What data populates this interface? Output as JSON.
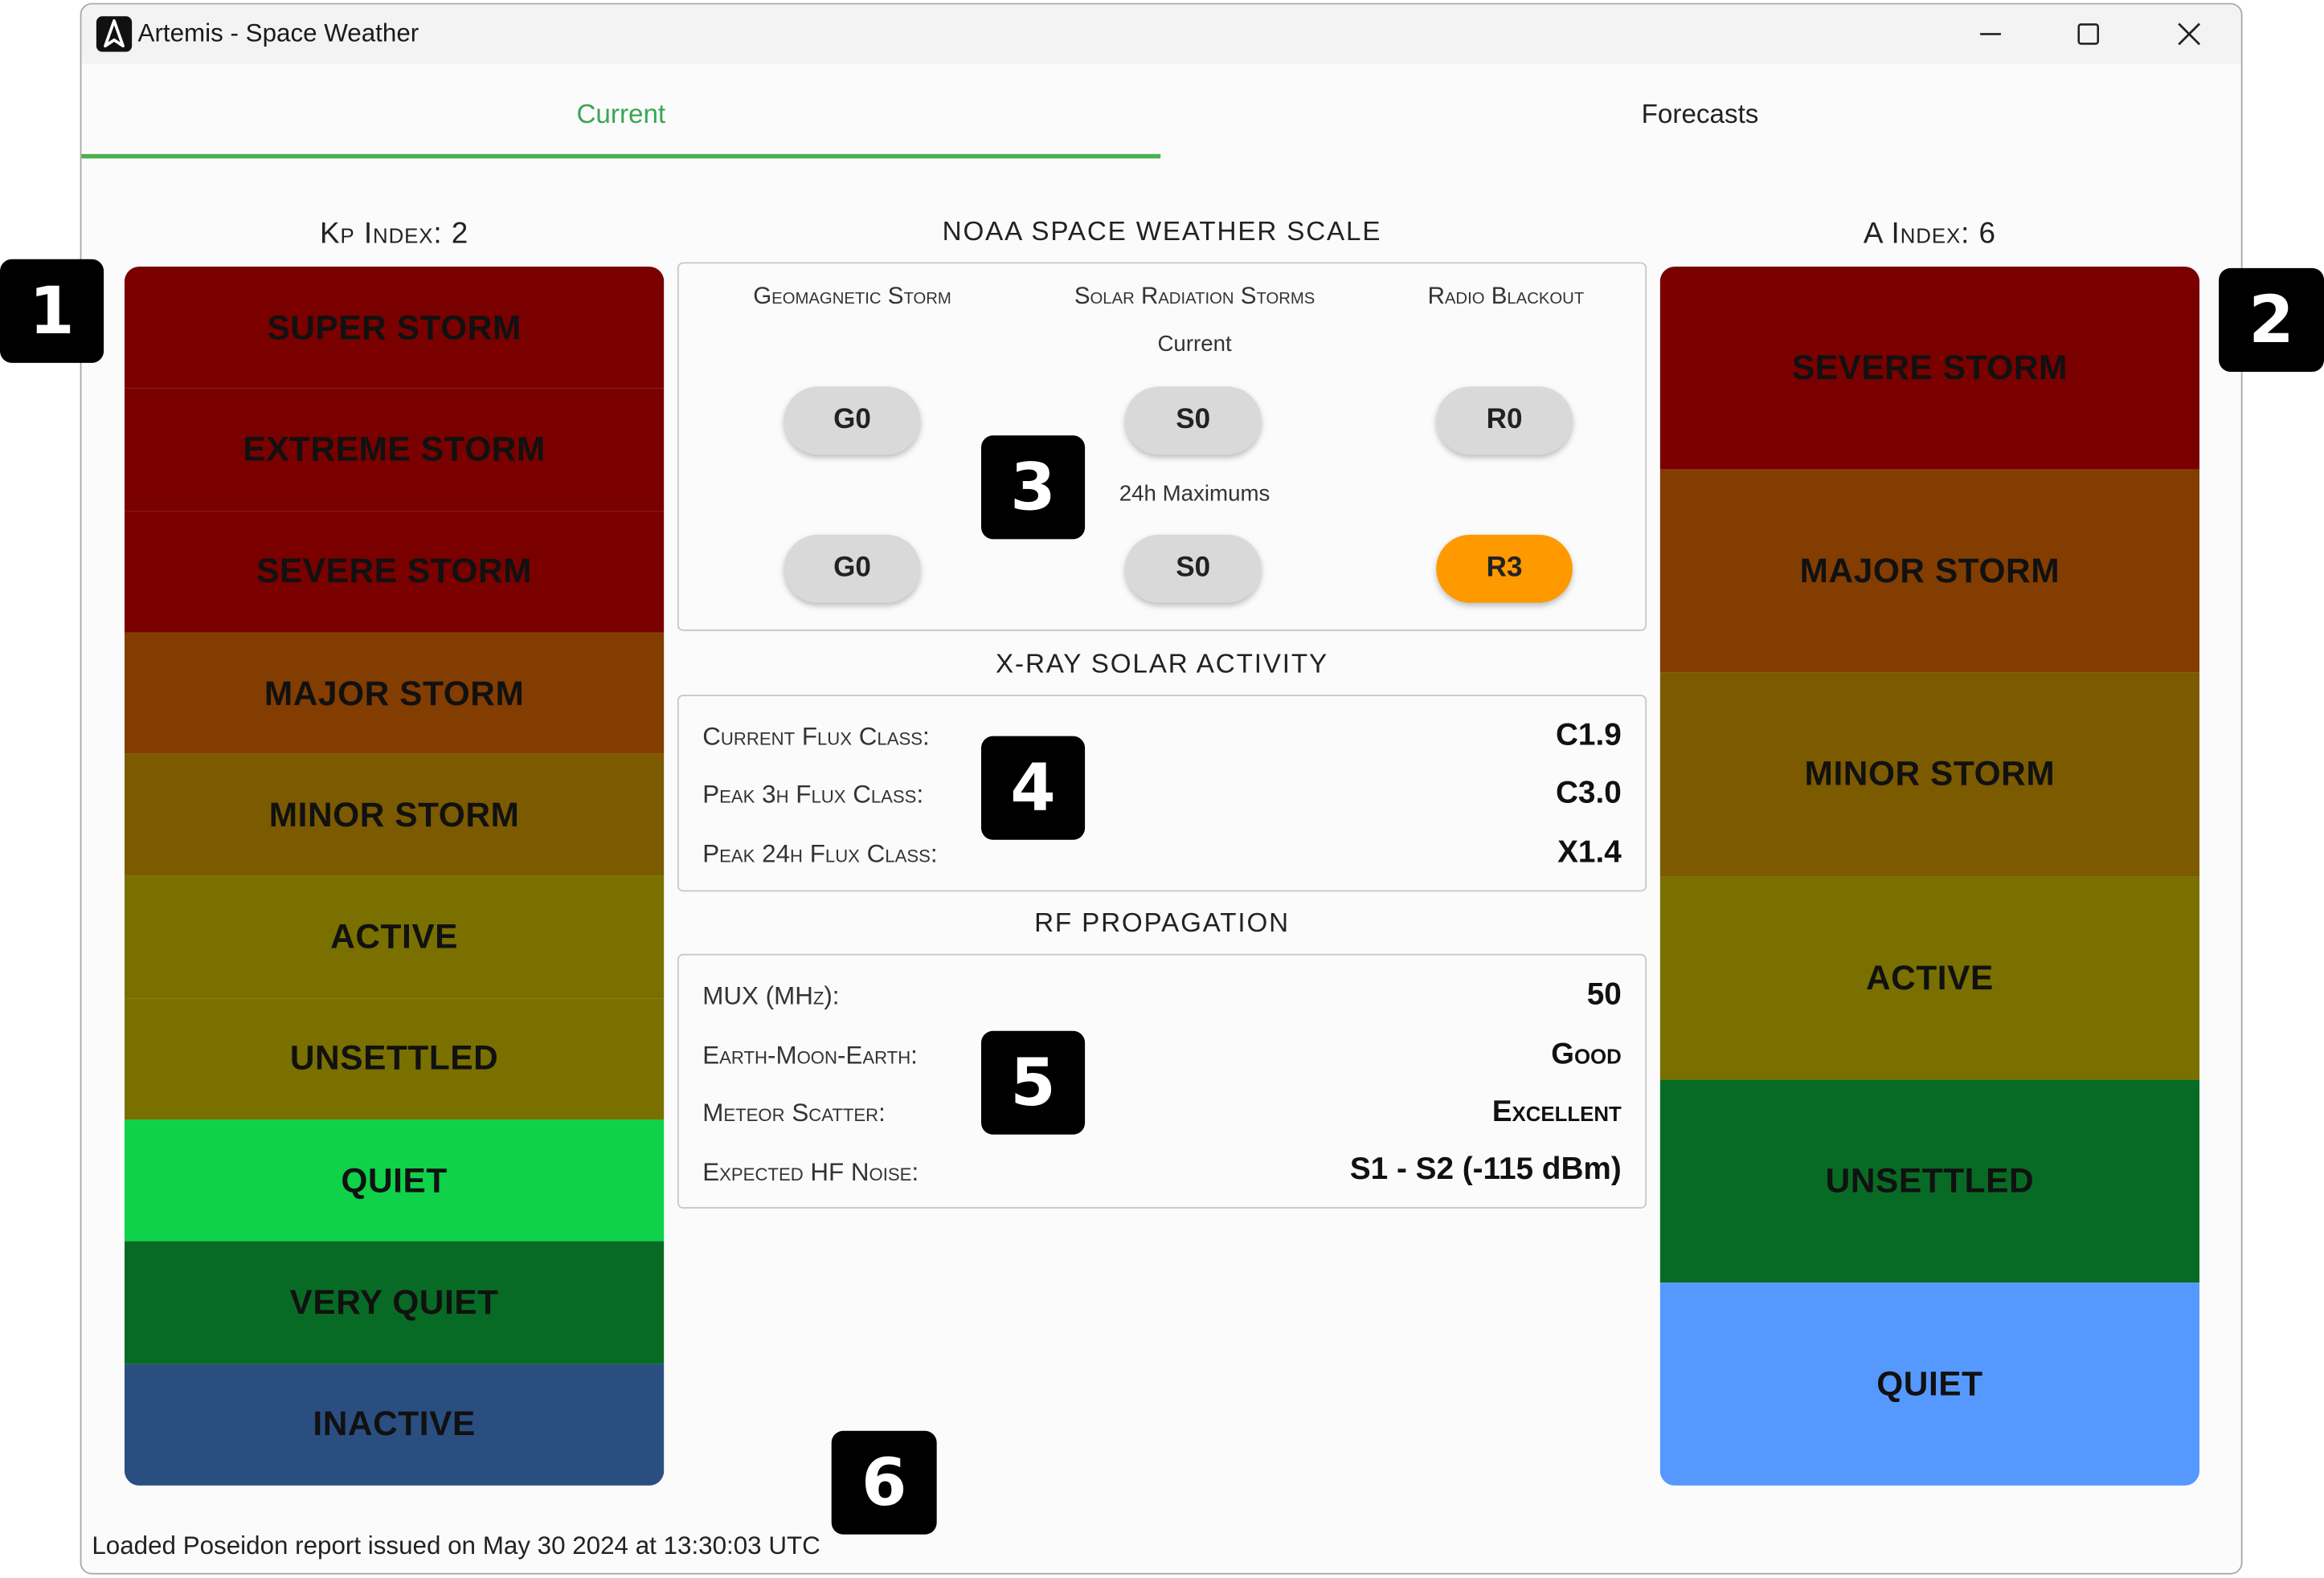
{
  "window": {
    "title": "Artemis - Space Weather"
  },
  "tabs": [
    {
      "label": "Current",
      "active": true
    },
    {
      "label": "Forecasts",
      "active": false
    }
  ],
  "kp": {
    "title": "Kp Index: 2",
    "levels": [
      {
        "label": "SUPER STORM",
        "color": "#7a0000"
      },
      {
        "label": "EXTREME STORM",
        "color": "#7a0000"
      },
      {
        "label": "SEVERE STORM",
        "color": "#7a0000"
      },
      {
        "label": "MAJOR STORM",
        "color": "#843d00"
      },
      {
        "label": "MINOR STORM",
        "color": "#7c5a00"
      },
      {
        "label": "ACTIVE",
        "color": "#797000"
      },
      {
        "label": "UNSETTLED",
        "color": "#797000"
      },
      {
        "label": "QUIET",
        "color": "#0fd14a"
      },
      {
        "label": "VERY QUIET",
        "color": "#086b25"
      },
      {
        "label": "INACTIVE",
        "color": "#2a4e80"
      }
    ]
  },
  "a_index": {
    "title": "A Index: 6",
    "levels": [
      {
        "label": "SEVERE STORM",
        "color": "#7a0000"
      },
      {
        "label": "MAJOR STORM",
        "color": "#843d00"
      },
      {
        "label": "MINOR STORM",
        "color": "#7c5a00"
      },
      {
        "label": "ACTIVE",
        "color": "#797000"
      },
      {
        "label": "UNSETTLED",
        "color": "#086b25"
      },
      {
        "label": "QUIET",
        "color": "#5599ff"
      }
    ]
  },
  "noaa": {
    "title": "NOAA SPACE WEATHER SCALE",
    "headers": [
      "Geomagnetic Storm",
      "Solar Radiation Storms",
      "Radio Blackout"
    ],
    "current_label": "Current",
    "max_label": "24h Maximums",
    "current": [
      "G0",
      "S0",
      "R0"
    ],
    "maximums": [
      "G0",
      "S0",
      "R3"
    ],
    "highlight_color": "#ff9900"
  },
  "xray": {
    "title": "X-RAY SOLAR ACTIVITY",
    "rows": [
      {
        "label": "Current Flux Class:",
        "value": "C1.9"
      },
      {
        "label": "Peak 3h Flux Class:",
        "value": "C3.0"
      },
      {
        "label": "Peak 24h Flux Class:",
        "value": "X1.4"
      }
    ]
  },
  "rf": {
    "title": "RF PROPAGATION",
    "rows": [
      {
        "label": "MUX (MHz):",
        "value": "50"
      },
      {
        "label": "Earth-Moon-Earth:",
        "value": "Good"
      },
      {
        "label": "Meteor Scatter:",
        "value": "Excellent"
      },
      {
        "label": "Expected HF Noise:",
        "value": "S1 - S2 (-115 dBm)"
      }
    ]
  },
  "status": "Loaded Poseidon report issued on May 30 2024 at 13:30:03 UTC",
  "badges": [
    "1",
    "2",
    "3",
    "4",
    "5",
    "6"
  ]
}
